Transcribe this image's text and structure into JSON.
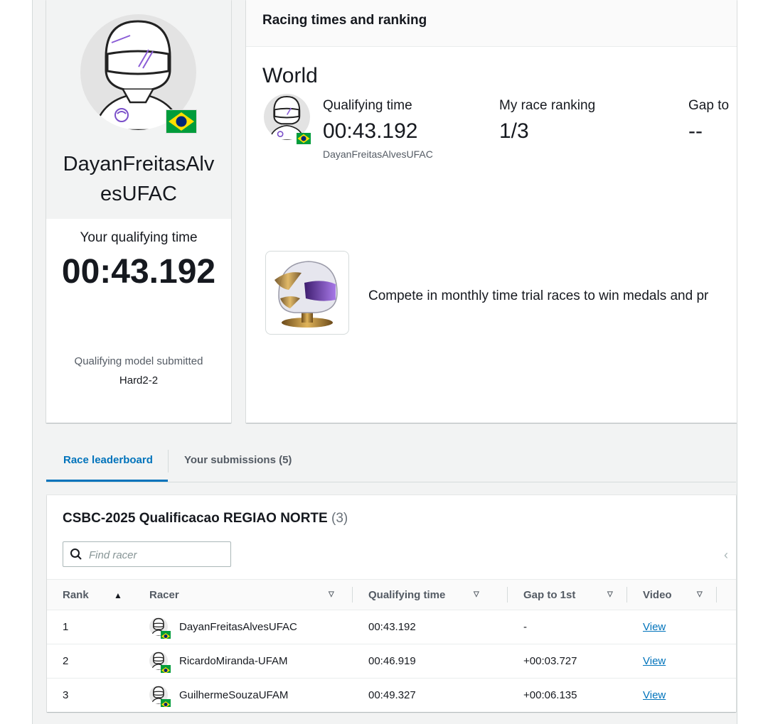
{
  "profile": {
    "racer_name": "DayanFreitasAlvesUFAC",
    "qualifying_label": "Your qualifying time",
    "qualifying_time": "00:43.192",
    "model_label": "Qualifying model submitted",
    "model_name": "Hard2-2"
  },
  "racing": {
    "header": "Racing times and ranking",
    "scope": "World",
    "stats": {
      "qualifying_label": "Qualifying time",
      "qualifying_value": "00:43.192",
      "racer_sub": "DayanFreitasAlvesUFAC",
      "ranking_label": "My race ranking",
      "ranking_value": "1/3",
      "gap_label": "Gap to",
      "gap_value": "--"
    },
    "promo_text": "Compete in monthly time trial races to win medals and pr"
  },
  "tabs": [
    {
      "label": "Race leaderboard",
      "active": true
    },
    {
      "label": "Your submissions (5)",
      "active": false
    }
  ],
  "leaderboard": {
    "title": "CSBC-2025 Qualificacao REGIAO NORTE",
    "count": "(3)",
    "search_placeholder": "Find racer",
    "columns": [
      "Rank",
      "Racer",
      "Qualifying time",
      "Gap to 1st",
      "Video"
    ],
    "rows": [
      {
        "rank": "1",
        "racer": "DayanFreitasAlvesUFAC",
        "time": "00:43.192",
        "gap": "-",
        "video": "View"
      },
      {
        "rank": "2",
        "racer": "RicardoMiranda-UFAM",
        "time": "00:46.919",
        "gap": "+00:03.727",
        "video": "View"
      },
      {
        "rank": "3",
        "racer": "GuilhermeSouzaUFAM",
        "time": "00:49.327",
        "gap": "+00:06.135",
        "video": "View"
      }
    ]
  },
  "colors": {
    "link": "#0073bb",
    "flag_green": "#009c3b",
    "flag_yellow": "#ffdf00",
    "flag_blue": "#002776"
  },
  "icons": [
    "helmet-avatar-icon",
    "brazil-flag-icon",
    "medal-helmet-icon",
    "search-icon",
    "sort-ascending-icon",
    "sort-descending-icon",
    "chevron-left-icon"
  ]
}
